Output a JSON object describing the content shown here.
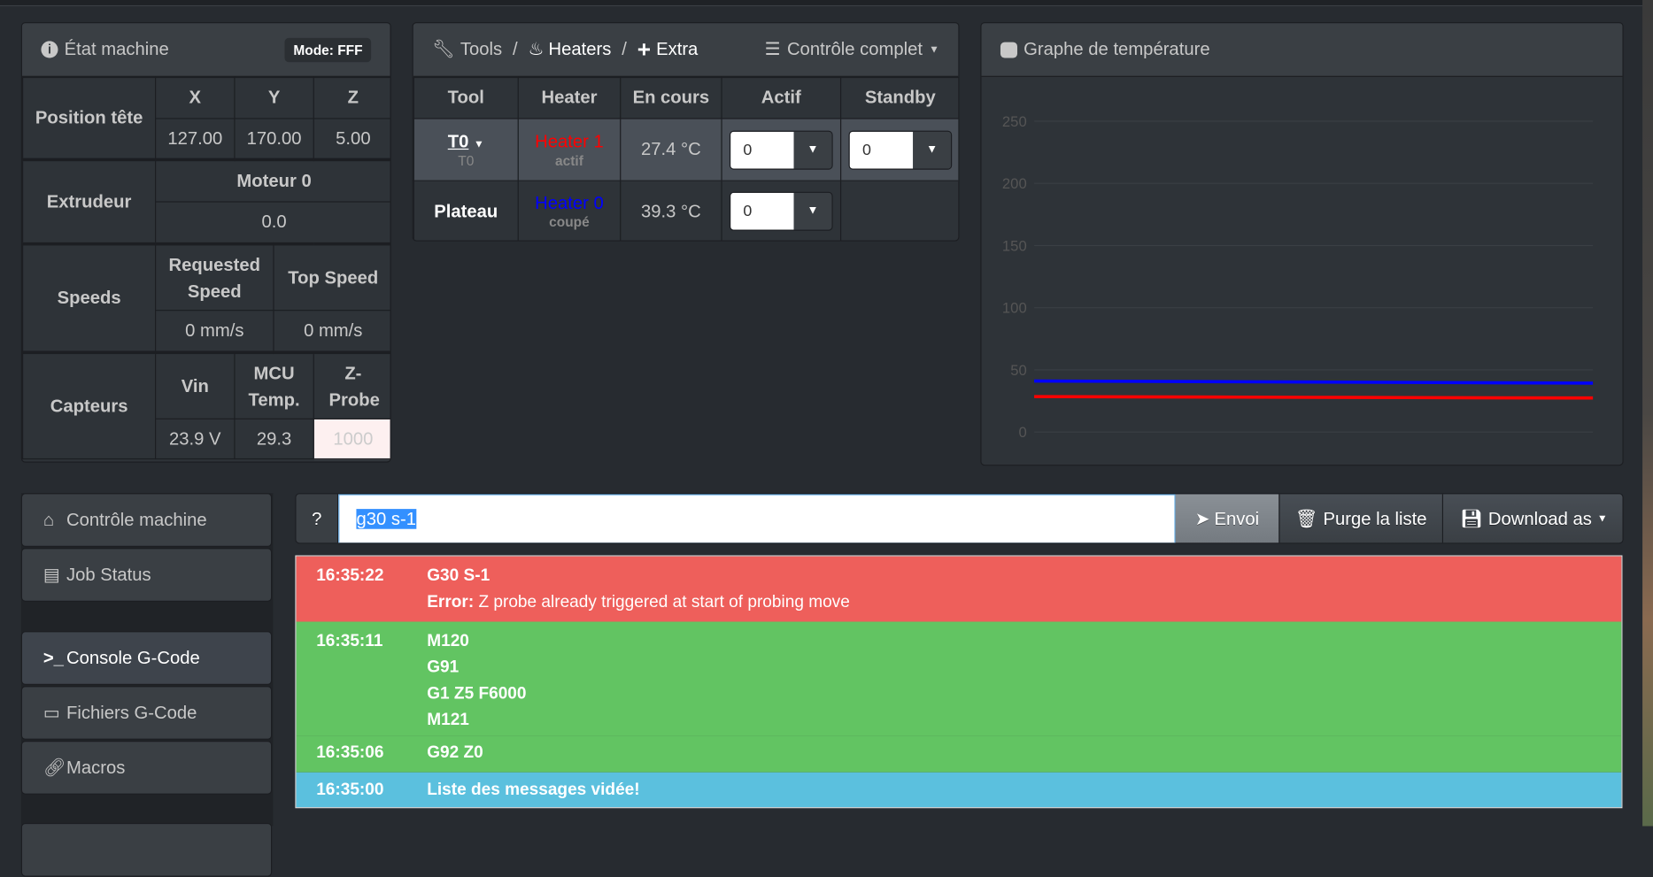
{
  "machine_status": {
    "title": "État machine",
    "mode": "Mode: FFF",
    "head_position": {
      "label": "Position tête",
      "axes": [
        "X",
        "Y",
        "Z"
      ],
      "values": [
        "127.00",
        "170.00",
        "5.00"
      ]
    },
    "extruder": {
      "label": "Extrudeur",
      "drive": "Moteur 0",
      "value": "0.0"
    },
    "speeds": {
      "label": "Speeds",
      "requested_label": "Requested Speed",
      "top_label": "Top Speed",
      "requested": "0 mm/s",
      "top": "0 mm/s"
    },
    "sensors": {
      "label": "Capteurs",
      "headers": [
        "Vin",
        "MCU Temp.",
        "Z-Probe"
      ],
      "values": [
        "23.9 V",
        "29.3",
        "1000"
      ]
    }
  },
  "tools": {
    "title_tools": "Tools",
    "title_heaters": "Heaters",
    "title_extra": "Extra",
    "control": "Contrôle complet",
    "headers": [
      "Tool",
      "Heater",
      "En cours",
      "Actif",
      "Standby"
    ],
    "rows": [
      {
        "tool": "T0",
        "tool_sub": "T0",
        "heater": "Heater 1",
        "heater_color": "#ff0000",
        "state": "actif",
        "current": "27.4 °C",
        "active": "0",
        "standby": "0"
      },
      {
        "tool": "Plateau",
        "heater": "Heater 0",
        "heater_color": "#0000ff",
        "state": "coupé",
        "current": "39.3 °C",
        "active": "0"
      }
    ]
  },
  "chart_panel": {
    "title": "Graphe de température"
  },
  "chart_data": {
    "type": "line",
    "ylim": [
      0,
      250
    ],
    "yticks": [
      "0",
      "50",
      "100",
      "150",
      "200",
      "250"
    ],
    "grid": true,
    "series": [
      {
        "color": "#0000ff",
        "values": [
          41,
          40.8,
          40.5,
          40.2,
          39.9,
          39.6,
          39.3
        ]
      },
      {
        "color": "#ff0000",
        "values": [
          28.5,
          28.3,
          28.1,
          27.9,
          27.7,
          27.5,
          27.4
        ]
      }
    ]
  },
  "sidebar": {
    "items": [
      {
        "label": "Contrôle machine",
        "icon": "home-icon"
      },
      {
        "label": "Job Status",
        "icon": "printer-icon"
      },
      {
        "label": "Console G-Code",
        "icon": "terminal-icon"
      },
      {
        "label": "Fichiers G-Code",
        "icon": "hdd-icon"
      },
      {
        "label": "Macros",
        "icon": "link-icon"
      }
    ]
  },
  "console": {
    "help": "?",
    "input": "g30 s-1",
    "send": "Envoi",
    "purge": "Purge la liste",
    "download": "Download as",
    "log": [
      {
        "time": "16:35:22",
        "lines": [
          "G30 S-1"
        ],
        "error_label": "Error:",
        "error": " Z probe already triggered at start of probing move",
        "color": "#ee5f5b"
      },
      {
        "time": "16:35:11",
        "lines": [
          "M120",
          "G91",
          "G1 Z5 F6000",
          "M121"
        ],
        "color": "#62c462"
      },
      {
        "time": "16:35:06",
        "lines": [
          "G92 Z0"
        ],
        "color": "#62c462"
      },
      {
        "time": "16:35:00",
        "lines": [
          "Liste des messages vidée!"
        ],
        "color": "#5bc0de"
      }
    ]
  }
}
